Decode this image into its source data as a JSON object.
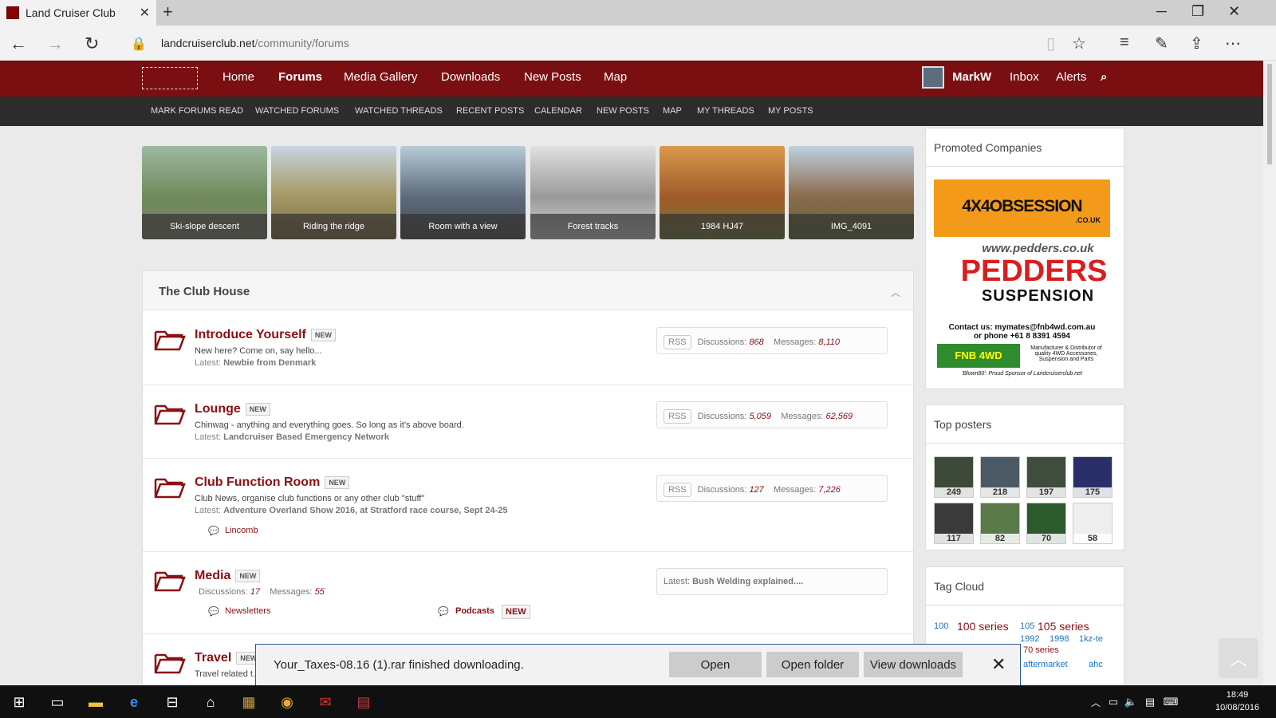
{
  "browser": {
    "tab_title": "Land Cruiser Club",
    "url_host": "landcruiserclub.net",
    "url_path": "/community/forums"
  },
  "nav": {
    "items": [
      "Home",
      "Forums",
      "Media Gallery",
      "Downloads",
      "New Posts",
      "Map"
    ],
    "active": "Forums",
    "user": "MarkW",
    "inbox": "Inbox",
    "alerts": "Alerts"
  },
  "subnav": [
    "MARK FORUMS READ",
    "WATCHED FORUMS",
    "WATCHED THREADS",
    "RECENT POSTS",
    "CALENDAR",
    "NEW POSTS",
    "MAP",
    "MY THREADS",
    "MY POSTS"
  ],
  "gallery": [
    "Ski-slope descent",
    "Riding the ridge",
    "Room with a view",
    "Forest tracks",
    "1984 HJ47",
    "IMG_4091"
  ],
  "section_title": "The Club House",
  "forums": [
    {
      "title": "Introduce Yourself",
      "badge": "NEW",
      "desc": "New here? Come on, say hello...",
      "latest_label": "Latest:",
      "latest": "Newbie from Denmark",
      "rss": "RSS",
      "disc_label": "Discussions:",
      "disc": "868",
      "msg_label": "Messages:",
      "msg": "8,110"
    },
    {
      "title": "Lounge",
      "badge": "NEW",
      "desc": "Chinwag - anything and everything goes. So long as it's above board.",
      "latest_label": "Latest:",
      "latest": "Landcruiser Based Emergency Network",
      "rss": "RSS",
      "disc_label": "Discussions:",
      "disc": "5,059",
      "msg_label": "Messages:",
      "msg": "62,569"
    },
    {
      "title": "Club Function Room",
      "badge": "NEW",
      "desc": "Club News, organise club functions or any other club \"stuff\"",
      "latest_label": "Latest:",
      "latest": "Adventure Overland Show 2016, at Stratford race course, Sept 24-25",
      "sub": "Lincomb",
      "rss": "RSS",
      "disc_label": "Discussions:",
      "disc": "127",
      "msg_label": "Messages:",
      "msg": "7,226"
    },
    {
      "title": "Media",
      "badge": "NEW",
      "disc_label": "Discussions:",
      "disc": "17",
      "msg_label": "Messages:",
      "msg": "55",
      "sub1": "Newsletters",
      "sub2": "Podcasts",
      "sub2_badge": "NEW",
      "latest_label": "Latest:",
      "latest": "Bush Welding explained...."
    },
    {
      "title": "Travel",
      "badge": "NEW",
      "desc": "Travel related t..."
    }
  ],
  "sidebar": {
    "promoted_title": "Promoted Companies",
    "ad1_line1": "4X4OBSESSION",
    "ad1_line2": ".CO.UK",
    "ad2_url": "www.pedders.co.uk",
    "ad2_line1": "PEDDERS",
    "ad2_line2": "SUSPENSION",
    "ad3_contact": "Contact us: mymates@fnb4wd.com.au",
    "ad3_phone": "or phone +61 8 8391 4594",
    "ad3_brand": "FNB 4WD",
    "ad3_desc": "Manufacturer & Distributor of quality 4WD Accessories, Suspension and Parts",
    "ad3_foot": "'Blown80': Proud Sponsor of Landcruiserclub.net",
    "top_posters_title": "Top posters",
    "posters": [
      "249",
      "218",
      "197",
      "175",
      "117",
      "82",
      "70",
      "58"
    ],
    "tag_cloud_title": "Tag Cloud",
    "tags": [
      "100",
      "100 series",
      "105",
      "105 series",
      "1992",
      "1998",
      "1kz-te",
      "70 series",
      "aftermarket",
      "ahc"
    ]
  },
  "download": {
    "message": "Your_Taxes-08.16 (1).rar finished downloading.",
    "open": "Open",
    "open_folder": "Open folder",
    "view_downloads": "View downloads"
  },
  "taskbar": {
    "time": "18:49",
    "date": "10/08/2016"
  }
}
